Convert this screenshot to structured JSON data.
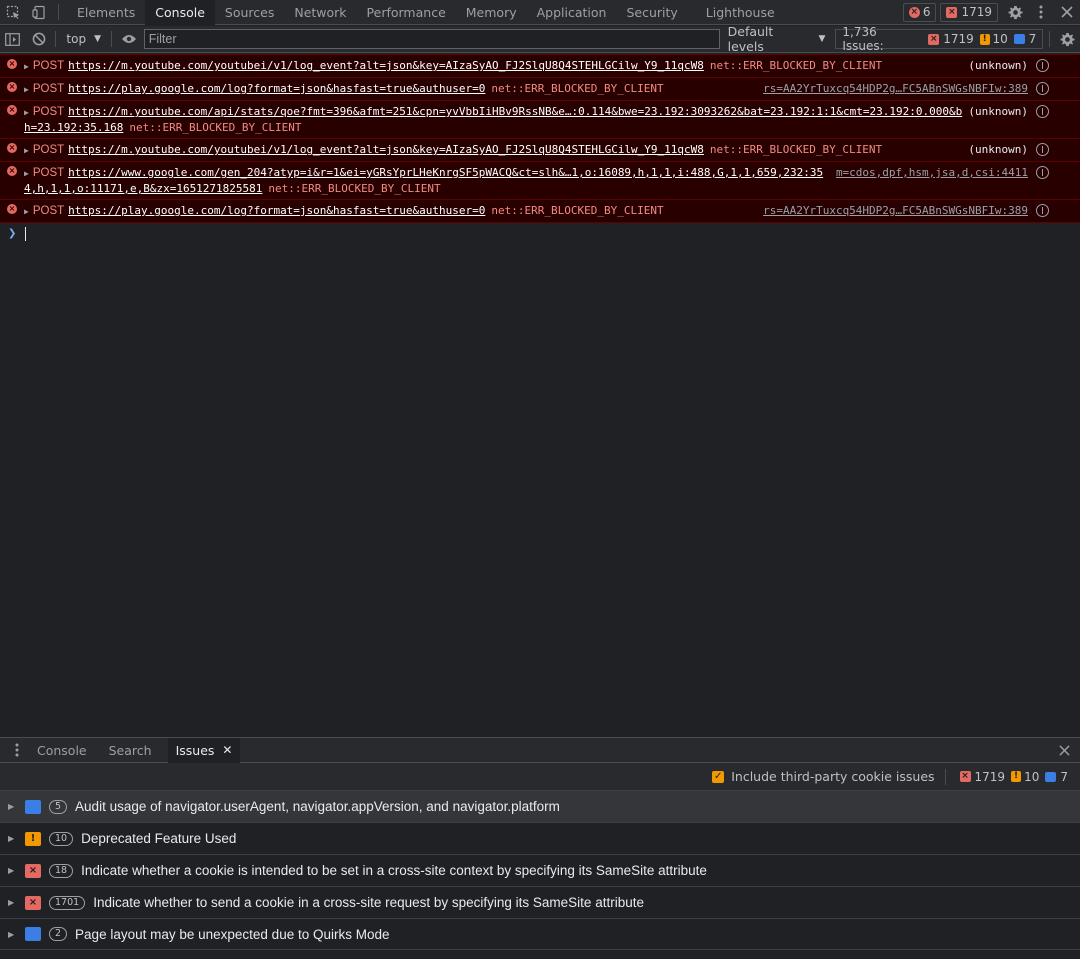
{
  "devtools": {
    "tabs": [
      "Elements",
      "Console",
      "Sources",
      "Network",
      "Performance",
      "Memory",
      "Application",
      "Security",
      "Lighthouse"
    ],
    "active_tab": "Console",
    "counts": {
      "errors": "6",
      "issues_errors": "1719"
    }
  },
  "console_toolbar": {
    "context": "top",
    "filter_placeholder": "Filter",
    "levels": "Default levels",
    "issues_label": "1,736 Issues:",
    "issues_err": "1719",
    "issues_warn": "10",
    "issues_info": "7"
  },
  "messages": [
    {
      "method": "POST",
      "url": "https://m.youtube.com/youtubei/v1/log_event?alt=json&key=AIzaSyAO_FJ2SlqU8Q4STEHLGCilw_Y9_11qcW8",
      "error": "net::ERR_BLOCKED_BY_CLIENT",
      "source": "(unknown)"
    },
    {
      "method": "POST",
      "url": "https://play.google.com/log?format=json&hasfast=true&authuser=0",
      "error": "net::ERR_BLOCKED_BY_CLIENT",
      "source": "rs=AA2YrTuxcq54HDP2g…FC5ABnSWGsNBFIw:389"
    },
    {
      "method": "POST",
      "url": "https://m.youtube.com/api/stats/qoe?fmt=396&afmt=251&cpn=yvVbbIiHBv9RssNB&e…:0.114&bwe=23.192:3093262&bat=23.192:1:1&cmt=23.192:0.000&bh=23.192:35.168",
      "error": "net::ERR_BLOCKED_BY_CLIENT",
      "source": "(unknown)"
    },
    {
      "method": "POST",
      "url": "https://m.youtube.com/youtubei/v1/log_event?alt=json&key=AIzaSyAO_FJ2SlqU8Q4STEHLGCilw_Y9_11qcW8",
      "error": "net::ERR_BLOCKED_BY_CLIENT",
      "source": "(unknown)"
    },
    {
      "method": "POST",
      "url": "https://www.google.com/gen_204?atyp=i&r=1&ei=yGRsYprLHeKnrgSF5pWACQ&ct=slh&…1,o:16089,h,1,1,i:488,G,1,1,659,232:354,h,1,1,o:11171,e,B&zx=1651271825581",
      "error": "net::ERR_BLOCKED_BY_CLIENT",
      "source": "m=cdos,dpf,hsm,jsa,d,csi:4411"
    },
    {
      "method": "POST",
      "url": "https://play.google.com/log?format=json&hasfast=true&authuser=0",
      "error": "net::ERR_BLOCKED_BY_CLIENT",
      "source": "rs=AA2YrTuxcq54HDP2g…FC5ABnSWGsNBFIw:389"
    }
  ],
  "drawer": {
    "tabs": [
      "Console",
      "Search",
      "Issues"
    ],
    "active_tab": "Issues",
    "include_third_party": "Include third-party cookie issues",
    "counts": {
      "err": "1719",
      "warn": "10",
      "info": "7"
    }
  },
  "issues": [
    {
      "kind": "info",
      "count": "5",
      "title": "Audit usage of navigator.userAgent, navigator.appVersion, and navigator.platform"
    },
    {
      "kind": "warn",
      "count": "10",
      "title": "Deprecated Feature Used"
    },
    {
      "kind": "err",
      "count": "18",
      "title": "Indicate whether a cookie is intended to be set in a cross-site context by specifying its SameSite attribute"
    },
    {
      "kind": "err",
      "count": "1701",
      "title": "Indicate whether to send a cookie in a cross-site request by specifying its SameSite attribute"
    },
    {
      "kind": "info",
      "count": "2",
      "title": "Page layout may be unexpected due to Quirks Mode"
    }
  ],
  "colors": {
    "error": "#f28b82",
    "error_bg": "#290000",
    "warn": "#f29900",
    "info": "#3b7ee6",
    "accent": "#7cacf8"
  }
}
